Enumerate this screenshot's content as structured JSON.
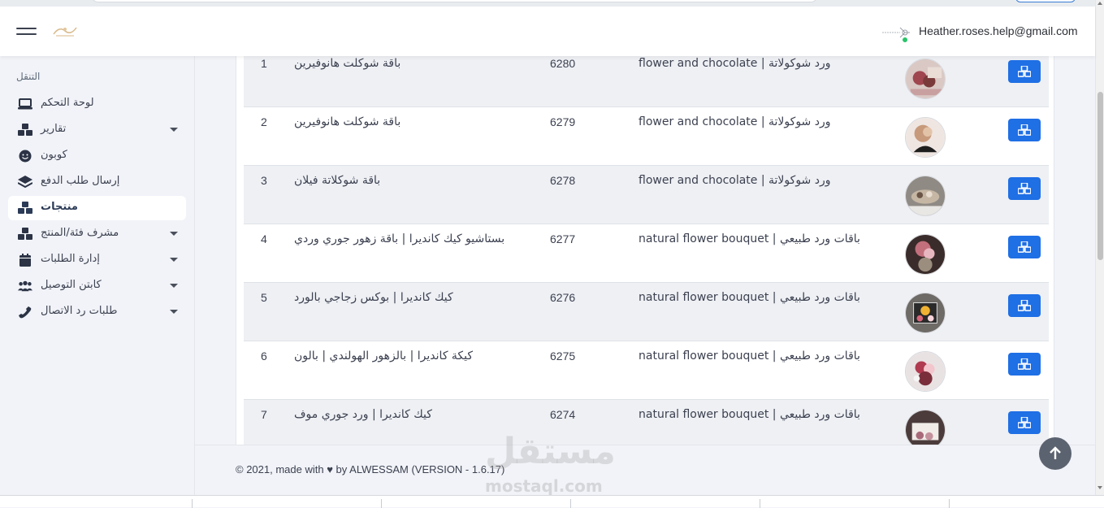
{
  "header": {
    "user_email": "Heather.roses.help@gmail.com"
  },
  "sidebar": {
    "section_title": "التنقل",
    "items": [
      {
        "label": "لوحة التحكم",
        "icon": "laptop-icon",
        "has_caret": false,
        "active": false
      },
      {
        "label": "تقارير",
        "icon": "cubes-icon",
        "has_caret": true,
        "active": false
      },
      {
        "label": "كوبون",
        "icon": "smile-icon",
        "has_caret": false,
        "active": false
      },
      {
        "label": "إرسال طلب الدفع",
        "icon": "layers-icon",
        "has_caret": false,
        "active": false
      },
      {
        "label": "منتجات",
        "icon": "cubes-icon",
        "has_caret": false,
        "active": true
      },
      {
        "label": "مشرف فئة/المنتج",
        "icon": "cubes-icon",
        "has_caret": true,
        "active": false
      },
      {
        "label": "إدارة الطلبات",
        "icon": "calendar-icon",
        "has_caret": true,
        "active": false
      },
      {
        "label": "كابتن التوصيل",
        "icon": "users-icon",
        "has_caret": true,
        "active": false
      },
      {
        "label": "طلبات رد الاتصال",
        "icon": "phone-icon",
        "has_caret": true,
        "active": false
      }
    ]
  },
  "products": {
    "rows": [
      {
        "num": "1",
        "name": "باقة شوكلت هانوفيرين",
        "sku": "6280",
        "category": "flower and chocolate | ورد شوكولاتة",
        "thumb_color": "#b4898b"
      },
      {
        "num": "2",
        "name": "باقة شوكلت هانوفيرين",
        "sku": "6279",
        "category": "flower and chocolate | ورد شوكولاتة",
        "thumb_color": "#c9a18e"
      },
      {
        "num": "3",
        "name": "باقة شوكلاتة فيلان",
        "sku": "6278",
        "category": "flower and chocolate | ورد شوكولاتة",
        "thumb_color": "#9a9187"
      },
      {
        "num": "4",
        "name": "بستاشيو كيك كانديرا | باقة زهور جوري وردي",
        "sku": "6277",
        "category": "natural flower bouquet | باقات ورد طبيعي",
        "thumb_color": "#6e4a48"
      },
      {
        "num": "5",
        "name": "كيك كانديرا | بوكس زجاجي بالورد",
        "sku": "6276",
        "category": "natural flower bouquet | باقات ورد طبيعي",
        "thumb_color": "#505050"
      },
      {
        "num": "6",
        "name": "كيكة كانديرا | بالزهور الهولندي | بالون",
        "sku": "6275",
        "category": "natural flower bouquet | باقات ورد طبيعي",
        "thumb_color": "#b98a8f"
      },
      {
        "num": "7",
        "name": "كيك كانديرا | ورد جوري موف",
        "sku": "6274",
        "category": "natural flower bouquet | باقات ورد طبيعي",
        "thumb_color": "#8e6b6c"
      }
    ]
  },
  "footer": {
    "text": "© 2021, made with ♥ by ALWESSAM (VERSION - 1.6.17)"
  },
  "watermark": {
    "arabic": "مستقل",
    "latin": "mostaql.com"
  },
  "colors": {
    "primary_button": "#1f6fe5",
    "online": "#29c36a"
  }
}
